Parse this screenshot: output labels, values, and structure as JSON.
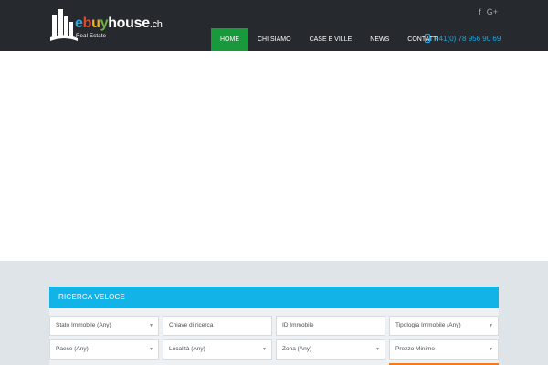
{
  "header": {
    "logo": {
      "segments": [
        {
          "text": "e",
          "color": "#2aa7df"
        },
        {
          "text": "b",
          "color": "#e8452c"
        },
        {
          "text": "u",
          "color": "#f3b21b"
        },
        {
          "text": "y",
          "color": "#6cb33f"
        },
        {
          "text": "house",
          "color": "#ffffff"
        }
      ],
      "tld": ".ch",
      "subtitle": "Real Estate"
    },
    "social": [
      {
        "icon": "facebook-icon",
        "glyph": "f"
      },
      {
        "icon": "google-plus-icon",
        "glyph": "G+"
      }
    ],
    "nav": [
      {
        "label": "HOME",
        "active": true
      },
      {
        "label": "CHI SIAMO",
        "active": false
      },
      {
        "label": "CASE E VILLE",
        "active": false
      },
      {
        "label": "NEWS",
        "active": false
      },
      {
        "label": "CONTATTI",
        "active": false
      }
    ],
    "phone": {
      "icon": "mobile-phone-icon",
      "number": "+41(0) 78 956 90 69"
    }
  },
  "search": {
    "title": "RICERCA VELOCE",
    "fields": [
      {
        "label": "Stato Immobile (Any)",
        "dropdown": true
      },
      {
        "label": "Chiave di ricerca",
        "dropdown": false
      },
      {
        "label": "ID Immobile",
        "dropdown": false
      },
      {
        "label": "Tipologia Immobile (Any)",
        "dropdown": true
      },
      {
        "label": "Paese (Any)",
        "dropdown": true
      },
      {
        "label": "Località (Any)",
        "dropdown": true
      },
      {
        "label": "Zona (Any)",
        "dropdown": true
      },
      {
        "label": "Prezzo Minimo",
        "dropdown": true
      }
    ]
  },
  "colors": {
    "header_bg": "#262a2e",
    "nav_active": "#189a3c",
    "accent_blue": "#12b4e8",
    "phone": "#1fa8e0",
    "search_bg": "#dfe4e8",
    "orange": "#f47a20"
  }
}
